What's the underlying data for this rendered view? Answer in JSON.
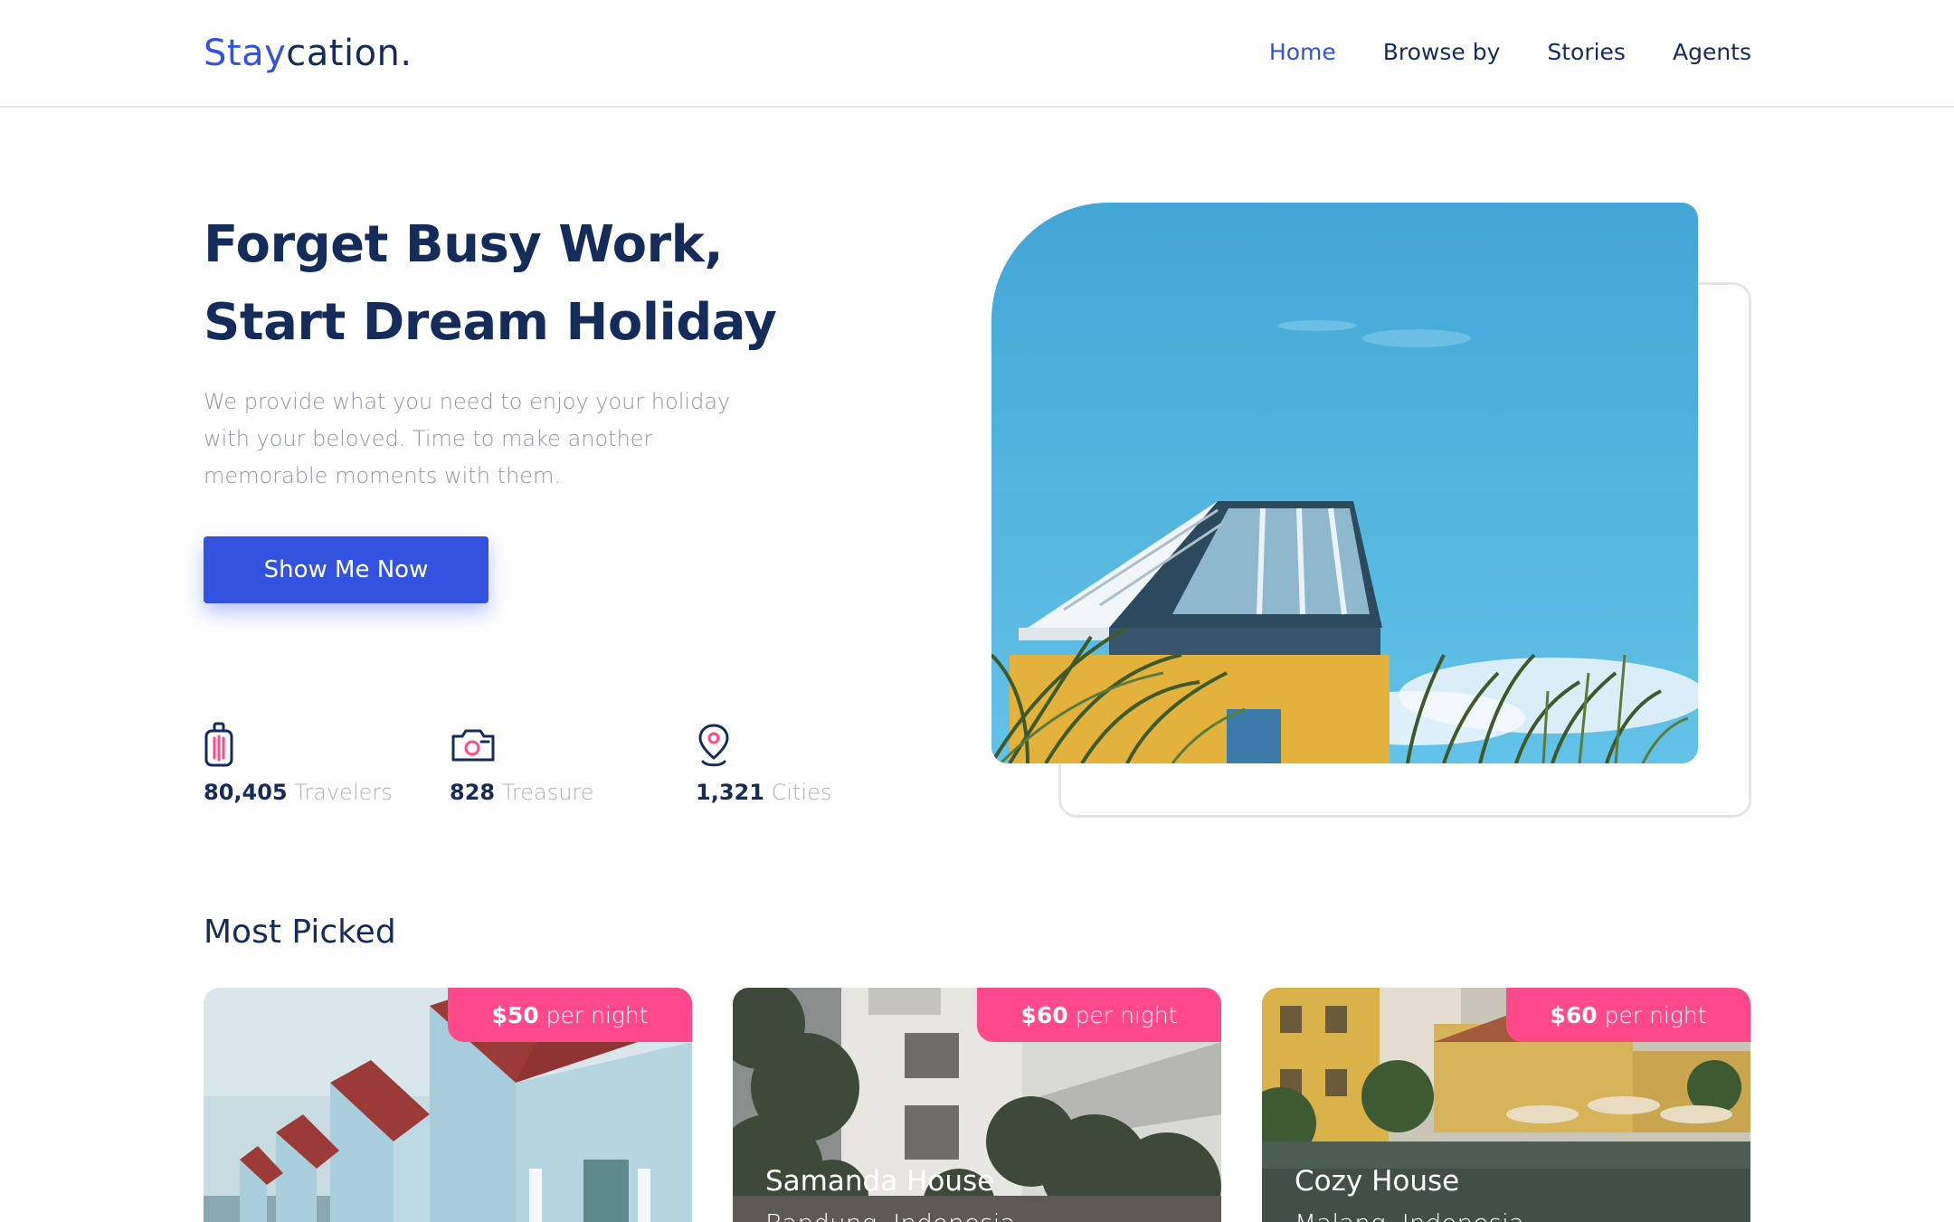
{
  "header": {
    "logo_primary": "Stay",
    "logo_secondary": "cation.",
    "nav": [
      {
        "label": "Home",
        "active": true
      },
      {
        "label": "Browse by",
        "active": false
      },
      {
        "label": "Stories",
        "active": false
      },
      {
        "label": "Agents",
        "active": false
      }
    ]
  },
  "hero": {
    "title_line1": "Forget Busy Work,",
    "title_line2": "Start Dream Holiday",
    "description": "We provide what you need to enjoy your holiday with your beloved. Time to make another memorable moments with them.",
    "cta_label": "Show Me Now",
    "stats": [
      {
        "value": "80,405",
        "label": "Travelers",
        "icon": "suitcase-icon"
      },
      {
        "value": "828",
        "label": "Treasure",
        "icon": "camera-icon"
      },
      {
        "value": "1,321",
        "label": "Cities",
        "icon": "map-pin-icon"
      }
    ]
  },
  "most_picked": {
    "title": "Most Picked",
    "cards": [
      {
        "price": "$50",
        "unit": "per night",
        "name": "",
        "location": ""
      },
      {
        "price": "$60",
        "unit": "per night",
        "name": "Samanda House",
        "location": "Bandung, Indonesia"
      },
      {
        "price": "$60",
        "unit": "per night",
        "name": "Cozy House",
        "location": "Malang, Indonesia"
      }
    ]
  },
  "colors": {
    "brand_blue": "#3252DF",
    "navy": "#152C5B",
    "pink": "#FF498B",
    "muted_text": "#B0B0B0"
  }
}
